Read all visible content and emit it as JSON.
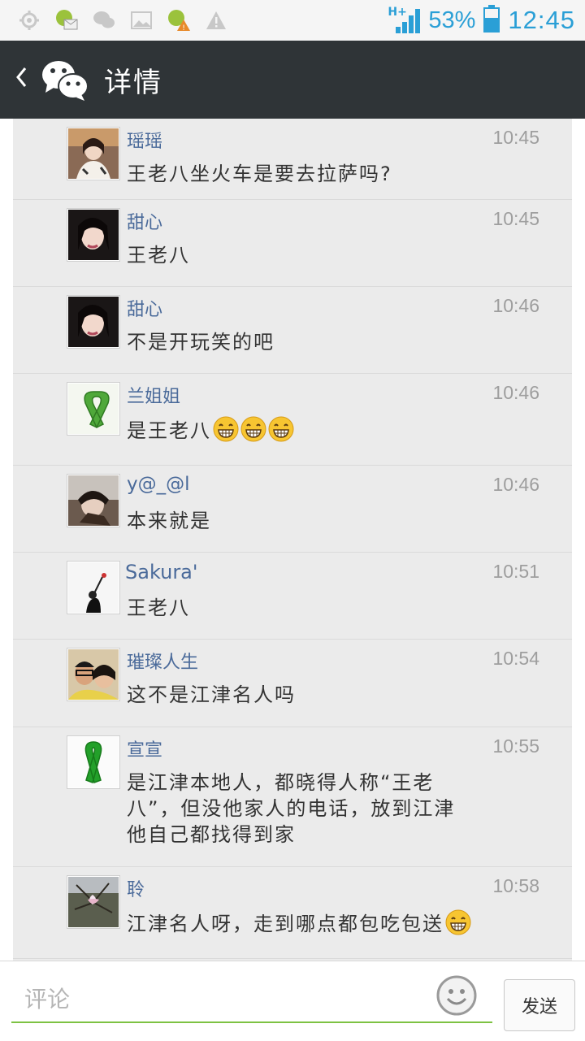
{
  "status_bar": {
    "network": "H+",
    "battery": "53%",
    "time": "12:45"
  },
  "header": {
    "back_icon": "chevron-left-icon",
    "logo_icon": "wechat-logo-icon",
    "title": "详情"
  },
  "comments": [
    {
      "name": "瑶瑶",
      "time": "10:45",
      "text": "王老八坐火车是要去拉萨吗?",
      "emoji": 0,
      "avatar": "photo"
    },
    {
      "name": "甜心",
      "time": "10:45",
      "text": "王老八",
      "emoji": 0,
      "avatar": "photo"
    },
    {
      "name": "甜心",
      "time": "10:46",
      "text": "不是开玩笑的吧",
      "emoji": 0,
      "avatar": "photo"
    },
    {
      "name": "兰姐姐",
      "time": "10:46",
      "text": "是王老八",
      "emoji": 3,
      "avatar": "ribbon"
    },
    {
      "name": "y@_@l",
      "time": "10:46",
      "text": "本来就是",
      "emoji": 0,
      "avatar": "photo"
    },
    {
      "name": "Sakura'",
      "time": "10:51",
      "text": "王老八",
      "emoji": 0,
      "avatar": "photo"
    },
    {
      "name": "璀璨人生",
      "time": "10:54",
      "text": "这不是江津名人吗",
      "emoji": 0,
      "avatar": "photo"
    },
    {
      "name": "宣宣",
      "time": "10:55",
      "text": "是江津本地人，都晓得人称“王老八”，但没他家人的电话，放到江津他自己都找得到家",
      "emoji": 0,
      "avatar": "ribbon"
    },
    {
      "name": "聆",
      "time": "10:58",
      "text": "江津名人呀，走到哪点都包吃包送",
      "emoji": 1,
      "avatar": "photo"
    }
  ],
  "input": {
    "placeholder": "评论",
    "send_label": "发送",
    "emoji_icon": "smiley-icon"
  },
  "colors": {
    "titlebar": "#2f3437",
    "name": "#4a6a9a",
    "accent_green": "#7dc243",
    "status_blue": "#2a9fd6"
  }
}
